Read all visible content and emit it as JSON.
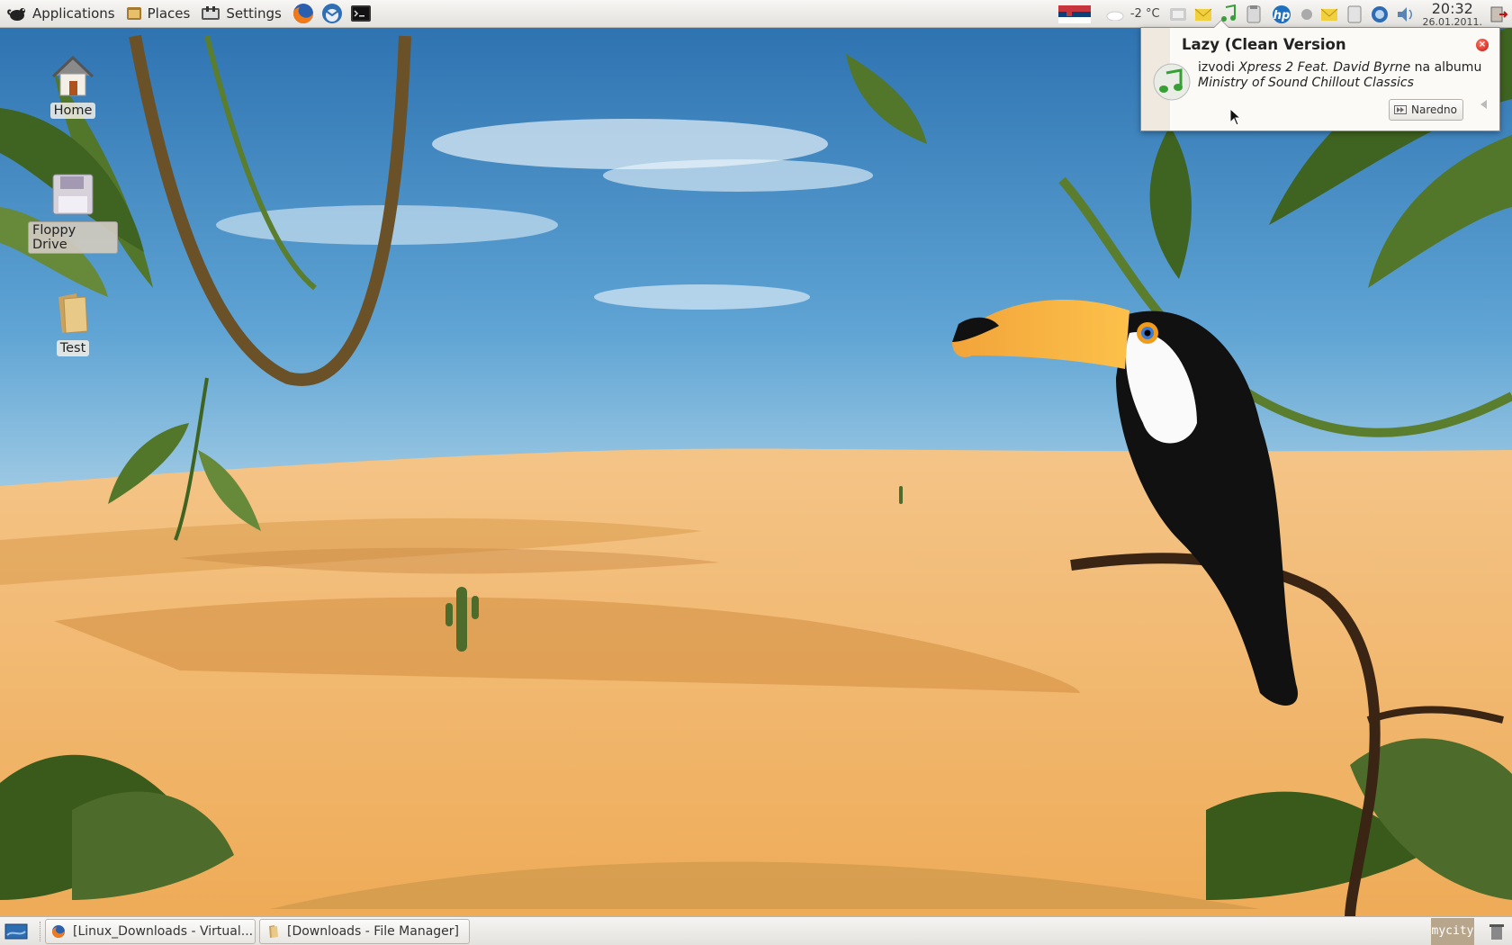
{
  "top_panel": {
    "menus": [
      {
        "label": "Applications",
        "icon": "xfce-mouse-icon"
      },
      {
        "label": "Places",
        "icon": "places-folder-icon"
      },
      {
        "label": "Settings",
        "icon": "settings-icon"
      }
    ],
    "launchers": [
      "firefox-icon",
      "thunderbird-icon",
      "terminal-icon"
    ],
    "tray": {
      "weather": "-2 °C",
      "clock_time": "20:32",
      "clock_date": "26.01.2011."
    }
  },
  "desktop_icons": [
    {
      "label": "Home",
      "icon": "home-icon"
    },
    {
      "label": "Floppy Drive",
      "icon": "floppy-drive-icon"
    },
    {
      "label": "Test",
      "icon": "folder-icon"
    }
  ],
  "notification": {
    "title": "Lazy (Clean Version",
    "performs": "izvodi",
    "artist": "Xpress 2 Feat. David Byrne",
    "on_album": "na albumu",
    "album": "Ministry of Sound Chillout Classics",
    "next_button": "Naredno",
    "icon": "music-note-icon"
  },
  "taskbar": {
    "tasks": [
      {
        "label": "[Linux_Downloads - Virtual...",
        "icon": "firefox-icon"
      },
      {
        "label": "[Downloads - File Manager]",
        "icon": "folder-icon"
      }
    ],
    "watermark": "mycity"
  },
  "colors": {
    "sky": "#3f8fc7",
    "sand": "#f1b365",
    "toucan_beak": "#f5a221",
    "panel": "#eceae6"
  }
}
